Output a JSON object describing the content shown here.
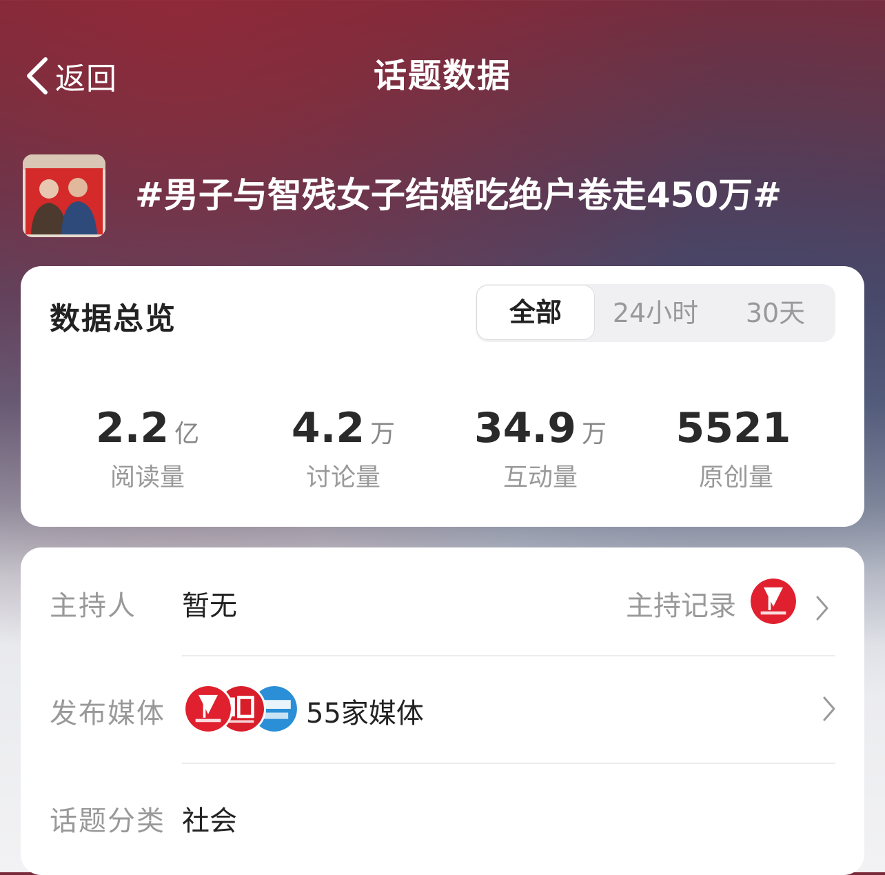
{
  "header": {
    "back_label": "返回",
    "title": "话题数据"
  },
  "topic": {
    "name": "#男子与智残女子结婚吃绝户卷走450万#"
  },
  "overview": {
    "title": "数据总览",
    "tabs": [
      {
        "label": "全部",
        "active": true
      },
      {
        "label": "24小时",
        "active": false
      },
      {
        "label": "30天",
        "active": false
      }
    ],
    "stats": [
      {
        "value": "2.2",
        "unit": "亿",
        "label": "阅读量"
      },
      {
        "value": "4.2",
        "unit": "万",
        "label": "讨论量"
      },
      {
        "value": "34.9",
        "unit": "万",
        "label": "互动量"
      },
      {
        "value": "5521",
        "unit": "",
        "label": "原创量"
      }
    ]
  },
  "info": {
    "host": {
      "label": "主持人",
      "value": "暂无",
      "link": "主持记录"
    },
    "media": {
      "label": "发布媒体",
      "value": "55家媒体"
    },
    "category": {
      "label": "话题分类",
      "value": "社会"
    }
  },
  "colors": {
    "accent_red": "#e0202e",
    "media_blue": "#2a8fd6"
  },
  "icons": {
    "back": "chevron-left-icon",
    "arrow": "chevron-right-icon"
  }
}
